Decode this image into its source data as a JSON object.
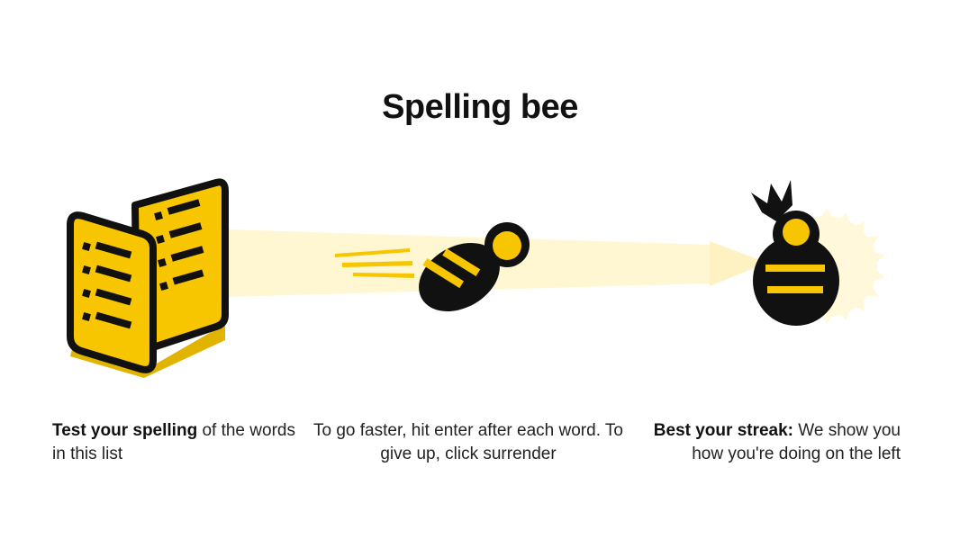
{
  "title": "Spelling bee",
  "colors": {
    "bee_yellow": "#F7C600",
    "beam": "#FFF6D2",
    "outline": "#111111",
    "glow": "#FFF8DA"
  },
  "icons": [
    "word-list-icon",
    "flying-bee-icon",
    "queen-bee-icon"
  ],
  "steps": [
    {
      "bold": "Test your spelling",
      "text": " of the words in this list"
    },
    {
      "bold": "",
      "text": "To go faster, hit enter after each word. To give up, click surrender"
    },
    {
      "bold": "Best your streak:",
      "text": " We show you how you're doing on the left"
    }
  ]
}
